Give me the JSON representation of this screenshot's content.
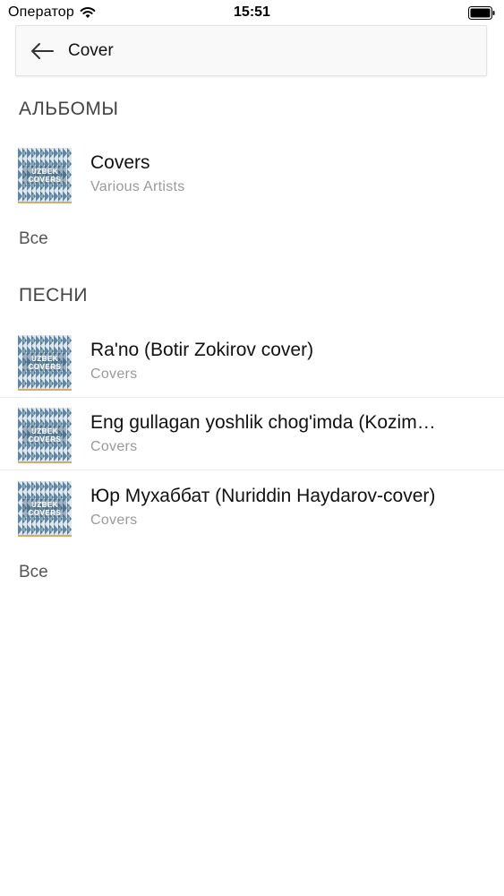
{
  "status_bar": {
    "carrier": "Оператор",
    "time": "15:51",
    "icons": [
      "wifi-icon",
      "battery-icon"
    ]
  },
  "search": {
    "query": "Cover",
    "back_icon": "arrow-left-icon"
  },
  "albums": {
    "header": "АЛЬБОМЫ",
    "items": [
      {
        "title": "Covers",
        "subtitle": "Various Artists",
        "cover_text": "UZBEK COVERS"
      }
    ],
    "see_all": "Все"
  },
  "songs": {
    "header": "ПЕСНИ",
    "items": [
      {
        "title": "Ra'no (Botir Zokirov cover)",
        "subtitle": "Covers",
        "cover_text": "UZBEK COVERS"
      },
      {
        "title": "Eng gullagan yoshlik chog'imda (Kozim…",
        "subtitle": "Covers",
        "cover_text": "UZBEK COVERS"
      },
      {
        "title": "Юр Мухаббат (Nuriddin Haydarov-cover)",
        "subtitle": "Covers",
        "cover_text": "UZBEK COVERS"
      }
    ],
    "see_all": "Все"
  },
  "colors": {
    "cover_blue": "#5f86a8",
    "cover_teal": "#7fb0b8",
    "cover_dark": "#2f4f6d",
    "cover_light": "#dfe8ee",
    "cover_accent": "#d9a86c"
  }
}
